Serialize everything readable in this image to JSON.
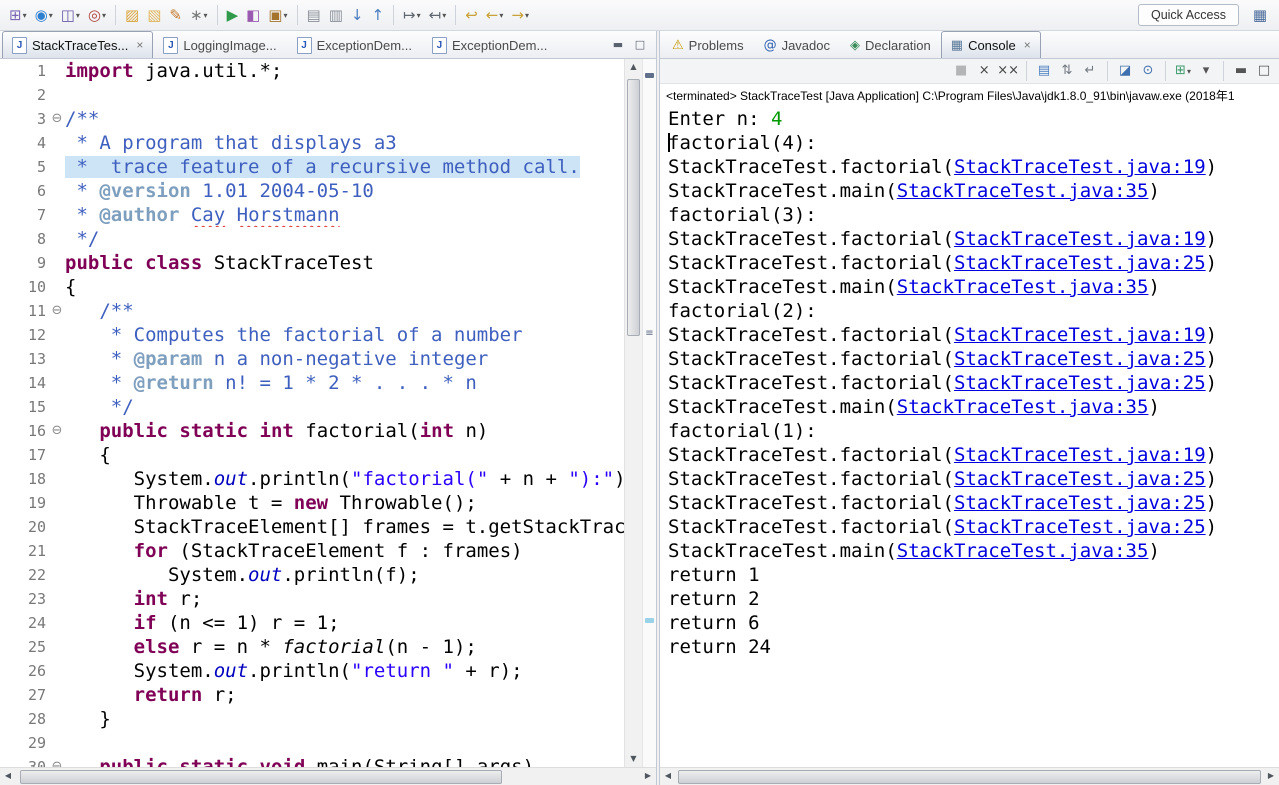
{
  "toolbar": {
    "quick_access": "Quick Access",
    "items": [
      {
        "name": "new-wizard",
        "glyph": "⊞",
        "color": "#7b68b5",
        "dropdown": true
      },
      {
        "name": "launch",
        "glyph": "◉",
        "color": "#2f7fd0",
        "dropdown": true
      },
      {
        "name": "save",
        "glyph": "◫",
        "color": "#6a5aa8",
        "dropdown": true
      },
      {
        "name": "external-tools",
        "glyph": "◎",
        "color": "#b04040",
        "dropdown": true
      },
      {
        "sep": true
      },
      {
        "name": "open-folder",
        "glyph": "▨",
        "color": "#d9a43c"
      },
      {
        "name": "open-type",
        "glyph": "▧",
        "color": "#e0b45a"
      },
      {
        "name": "edit-pencil",
        "glyph": "✎",
        "color": "#c47a2e"
      },
      {
        "name": "magic-wand",
        "glyph": "∗",
        "color": "#7a7a7a",
        "dropdown": true
      },
      {
        "sep": true
      },
      {
        "name": "run",
        "glyph": "▶",
        "color": "#2e9a4a"
      },
      {
        "name": "paint",
        "glyph": "◧",
        "color": "#995ab0"
      },
      {
        "name": "new-package",
        "glyph": "▣",
        "color": "#a5742c",
        "dropdown": true
      },
      {
        "sep": true
      },
      {
        "name": "copy-book",
        "glyph": "▤",
        "color": "#8a8f98"
      },
      {
        "name": "copy-page",
        "glyph": "▥",
        "color": "#8a8f98"
      },
      {
        "name": "import",
        "glyph": "↓",
        "color": "#4a7dbf"
      },
      {
        "name": "export",
        "glyph": "↑",
        "color": "#4a7dbf"
      },
      {
        "sep": true
      },
      {
        "name": "next-annotation",
        "glyph": "↦",
        "color": "#606770",
        "dropdown": true
      },
      {
        "name": "prev-annotation",
        "glyph": "↤",
        "color": "#606770",
        "dropdown": true
      },
      {
        "sep": true
      },
      {
        "name": "last-edit-location",
        "glyph": "↩",
        "color": "#caa23a"
      },
      {
        "name": "back",
        "glyph": "←",
        "color": "#caa23a",
        "dropdown": true
      },
      {
        "name": "forward",
        "glyph": "→",
        "color": "#caa23a",
        "dropdown": true
      }
    ]
  },
  "editor": {
    "tabs": [
      {
        "label": "StackTraceTes...",
        "active": true
      },
      {
        "label": "LoggingImage..."
      },
      {
        "label": "ExceptionDem..."
      },
      {
        "label": "ExceptionDem..."
      }
    ],
    "lines": [
      {
        "n": 1,
        "segs": [
          {
            "c": "kw",
            "t": "import"
          },
          {
            "c": "pl",
            "t": " java.util.*;"
          }
        ]
      },
      {
        "n": 2,
        "segs": []
      },
      {
        "n": 3,
        "fold": true,
        "segs": [
          {
            "c": "jd",
            "t": "/**"
          }
        ]
      },
      {
        "n": 4,
        "segs": [
          {
            "c": "jd",
            "t": " * A program that displays a3"
          }
        ]
      },
      {
        "n": 5,
        "hl": true,
        "segs": [
          {
            "c": "jd",
            "t": " *  trace feature of a recursive method call."
          }
        ]
      },
      {
        "n": 6,
        "segs": [
          {
            "c": "jd",
            "t": " * "
          },
          {
            "c": "jdt",
            "t": "@version"
          },
          {
            "c": "jd",
            "t": " 1.01 2004-05-10"
          }
        ]
      },
      {
        "n": 7,
        "segs": [
          {
            "c": "jd",
            "t": " * "
          },
          {
            "c": "jdt",
            "t": "@author"
          },
          {
            "c": "jd",
            "t": " "
          },
          {
            "c": "jd err",
            "t": "Cay"
          },
          {
            "c": "jd",
            "t": " "
          },
          {
            "c": "jd err",
            "t": "Horstmann"
          }
        ]
      },
      {
        "n": 8,
        "segs": [
          {
            "c": "jd",
            "t": " */"
          }
        ]
      },
      {
        "n": 9,
        "segs": [
          {
            "c": "kw",
            "t": "public"
          },
          {
            "c": "pl",
            "t": " "
          },
          {
            "c": "kw",
            "t": "class"
          },
          {
            "c": "pl",
            "t": " StackTraceTest"
          }
        ]
      },
      {
        "n": 10,
        "segs": [
          {
            "c": "pl",
            "t": "{"
          }
        ]
      },
      {
        "n": 11,
        "fold": true,
        "segs": [
          {
            "c": "pl",
            "t": "   "
          },
          {
            "c": "jd",
            "t": "/**"
          }
        ]
      },
      {
        "n": 12,
        "segs": [
          {
            "c": "jd",
            "t": "    * Computes the factorial of a number"
          }
        ]
      },
      {
        "n": 13,
        "segs": [
          {
            "c": "jd",
            "t": "    * "
          },
          {
            "c": "jdt",
            "t": "@param"
          },
          {
            "c": "jd",
            "t": " n a non-negative integer"
          }
        ]
      },
      {
        "n": 14,
        "segs": [
          {
            "c": "jd",
            "t": "    * "
          },
          {
            "c": "jdt",
            "t": "@return"
          },
          {
            "c": "jd",
            "t": " n! = 1 * 2 * . . . * n"
          }
        ]
      },
      {
        "n": 15,
        "segs": [
          {
            "c": "jd",
            "t": "    */"
          }
        ]
      },
      {
        "n": 16,
        "fold": true,
        "segs": [
          {
            "c": "pl",
            "t": "   "
          },
          {
            "c": "kw",
            "t": "public"
          },
          {
            "c": "pl",
            "t": " "
          },
          {
            "c": "kw",
            "t": "static"
          },
          {
            "c": "pl",
            "t": " "
          },
          {
            "c": "kw",
            "t": "int"
          },
          {
            "c": "pl",
            "t": " factorial("
          },
          {
            "c": "kw",
            "t": "int"
          },
          {
            "c": "pl",
            "t": " n)"
          }
        ]
      },
      {
        "n": 17,
        "segs": [
          {
            "c": "pl",
            "t": "   {"
          }
        ]
      },
      {
        "n": 18,
        "segs": [
          {
            "c": "pl",
            "t": "      System."
          },
          {
            "c": "sf",
            "t": "out"
          },
          {
            "c": "pl",
            "t": ".println("
          },
          {
            "c": "str",
            "t": "\"factorial(\""
          },
          {
            "c": "pl",
            "t": " + n + "
          },
          {
            "c": "str",
            "t": "\"):\""
          },
          {
            "c": "pl",
            "t": ");"
          }
        ]
      },
      {
        "n": 19,
        "segs": [
          {
            "c": "pl",
            "t": "      Throwable t = "
          },
          {
            "c": "kw",
            "t": "new"
          },
          {
            "c": "pl",
            "t": " Throwable();"
          }
        ]
      },
      {
        "n": 20,
        "segs": [
          {
            "c": "pl",
            "t": "      StackTraceElement[] frames = t.getStackTrace();"
          }
        ]
      },
      {
        "n": 21,
        "segs": [
          {
            "c": "pl",
            "t": "      "
          },
          {
            "c": "kw",
            "t": "for"
          },
          {
            "c": "pl",
            "t": " (StackTraceElement f : frames)"
          }
        ]
      },
      {
        "n": 22,
        "segs": [
          {
            "c": "pl",
            "t": "         System."
          },
          {
            "c": "sf",
            "t": "out"
          },
          {
            "c": "pl",
            "t": ".println(f);"
          }
        ]
      },
      {
        "n": 23,
        "segs": [
          {
            "c": "pl",
            "t": "      "
          },
          {
            "c": "kw",
            "t": "int"
          },
          {
            "c": "pl",
            "t": " r;"
          }
        ]
      },
      {
        "n": 24,
        "segs": [
          {
            "c": "pl",
            "t": "      "
          },
          {
            "c": "kw",
            "t": "if"
          },
          {
            "c": "pl",
            "t": " (n <= 1) r = 1;"
          }
        ]
      },
      {
        "n": 25,
        "segs": [
          {
            "c": "pl",
            "t": "      "
          },
          {
            "c": "kw",
            "t": "else"
          },
          {
            "c": "pl",
            "t": " r = n * "
          },
          {
            "c": "sm",
            "t": "factorial"
          },
          {
            "c": "pl",
            "t": "(n - 1);"
          }
        ]
      },
      {
        "n": 26,
        "segs": [
          {
            "c": "pl",
            "t": "      System."
          },
          {
            "c": "sf",
            "t": "out"
          },
          {
            "c": "pl",
            "t": ".println("
          },
          {
            "c": "str",
            "t": "\"return \""
          },
          {
            "c": "pl",
            "t": " + r);"
          }
        ]
      },
      {
        "n": 27,
        "segs": [
          {
            "c": "pl",
            "t": "      "
          },
          {
            "c": "kw",
            "t": "return"
          },
          {
            "c": "pl",
            "t": " r;"
          }
        ]
      },
      {
        "n": 28,
        "segs": [
          {
            "c": "pl",
            "t": "   }"
          }
        ]
      },
      {
        "n": 29,
        "segs": []
      },
      {
        "n": 30,
        "fold": true,
        "segs": [
          {
            "c": "pl",
            "t": "   "
          },
          {
            "c": "kw",
            "t": "public"
          },
          {
            "c": "pl",
            "t": " "
          },
          {
            "c": "kw",
            "t": "static"
          },
          {
            "c": "pl",
            "t": " "
          },
          {
            "c": "kw",
            "t": "void"
          },
          {
            "c": "pl",
            "t": " main(String[] args)"
          }
        ]
      }
    ]
  },
  "console": {
    "tabs": [
      {
        "label": "Problems",
        "icon_name": "problems-icon",
        "icon_glyph": "⚠",
        "icon_color": "#c99700"
      },
      {
        "label": "Javadoc",
        "icon_name": "javadoc-icon",
        "icon_glyph": "@",
        "icon_color": "#2a5db0"
      },
      {
        "label": "Declaration",
        "icon_name": "declaration-icon",
        "icon_glyph": "◈",
        "icon_color": "#3a8d5a"
      },
      {
        "label": "Console",
        "icon_name": "console-icon",
        "icon_glyph": "▦",
        "icon_color": "#5a7a9a",
        "active": true
      }
    ],
    "toolbar_items": [
      {
        "name": "terminate",
        "glyph": "■",
        "color": "#8d4a4a",
        "disabled": true
      },
      {
        "name": "remove-launch",
        "glyph": "×",
        "color": "#444444"
      },
      {
        "name": "remove-all-terminated",
        "glyph": "××",
        "color": "#444444"
      },
      {
        "sep": true
      },
      {
        "name": "clear-console",
        "glyph": "▤",
        "color": "#4a7dbf"
      },
      {
        "name": "scroll-lock",
        "glyph": "⇅",
        "color": "#707880"
      },
      {
        "name": "word-wrap",
        "glyph": "↵",
        "color": "#707880"
      },
      {
        "sep": true
      },
      {
        "name": "show-console-on-stdout",
        "glyph": "◪",
        "color": "#3f6fae"
      },
      {
        "name": "pin-console",
        "glyph": "⊙",
        "color": "#3f6fae"
      },
      {
        "sep": true
      },
      {
        "name": "open-console",
        "glyph": "⊞",
        "color": "#3a9a6a",
        "dropdown": true
      },
      {
        "name": "view-menu",
        "glyph": "▾",
        "color": "#555555"
      },
      {
        "sep": true
      },
      {
        "name": "minimize-view",
        "glyph": "▬",
        "color": "#555555"
      },
      {
        "name": "maximize-view",
        "glyph": "□",
        "color": "#555555"
      }
    ],
    "status": "<terminated> StackTraceTest [Java Application] C:\\Program Files\\Java\\jdk1.8.0_91\\bin\\javaw.exe (2018年1",
    "caret_line": 1,
    "lines": [
      [
        {
          "c": "out",
          "t": "Enter n: "
        },
        {
          "c": "in",
          "t": "4"
        }
      ],
      [
        {
          "c": "out",
          "t": "factorial(4):"
        }
      ],
      [
        {
          "c": "out",
          "t": "StackTraceTest.factorial("
        },
        {
          "c": "link",
          "t": "StackTraceTest.java:19"
        },
        {
          "c": "out",
          "t": ")"
        }
      ],
      [
        {
          "c": "out",
          "t": "StackTraceTest.main("
        },
        {
          "c": "link",
          "t": "StackTraceTest.java:35"
        },
        {
          "c": "out",
          "t": ")"
        }
      ],
      [
        {
          "c": "out",
          "t": "factorial(3):"
        }
      ],
      [
        {
          "c": "out",
          "t": "StackTraceTest.factorial("
        },
        {
          "c": "link",
          "t": "StackTraceTest.java:19"
        },
        {
          "c": "out",
          "t": ")"
        }
      ],
      [
        {
          "c": "out",
          "t": "StackTraceTest.factorial("
        },
        {
          "c": "link",
          "t": "StackTraceTest.java:25"
        },
        {
          "c": "out",
          "t": ")"
        }
      ],
      [
        {
          "c": "out",
          "t": "StackTraceTest.main("
        },
        {
          "c": "link",
          "t": "StackTraceTest.java:35"
        },
        {
          "c": "out",
          "t": ")"
        }
      ],
      [
        {
          "c": "out",
          "t": "factorial(2):"
        }
      ],
      [
        {
          "c": "out",
          "t": "StackTraceTest.factorial("
        },
        {
          "c": "link",
          "t": "StackTraceTest.java:19"
        },
        {
          "c": "out",
          "t": ")"
        }
      ],
      [
        {
          "c": "out",
          "t": "StackTraceTest.factorial("
        },
        {
          "c": "link",
          "t": "StackTraceTest.java:25"
        },
        {
          "c": "out",
          "t": ")"
        }
      ],
      [
        {
          "c": "out",
          "t": "StackTraceTest.factorial("
        },
        {
          "c": "link",
          "t": "StackTraceTest.java:25"
        },
        {
          "c": "out",
          "t": ")"
        }
      ],
      [
        {
          "c": "out",
          "t": "StackTraceTest.main("
        },
        {
          "c": "link",
          "t": "StackTraceTest.java:35"
        },
        {
          "c": "out",
          "t": ")"
        }
      ],
      [
        {
          "c": "out",
          "t": "factorial(1):"
        }
      ],
      [
        {
          "c": "out",
          "t": "StackTraceTest.factorial("
        },
        {
          "c": "link",
          "t": "StackTraceTest.java:19"
        },
        {
          "c": "out",
          "t": ")"
        }
      ],
      [
        {
          "c": "out",
          "t": "StackTraceTest.factorial("
        },
        {
          "c": "link",
          "t": "StackTraceTest.java:25"
        },
        {
          "c": "out",
          "t": ")"
        }
      ],
      [
        {
          "c": "out",
          "t": "StackTraceTest.factorial("
        },
        {
          "c": "link",
          "t": "StackTraceTest.java:25"
        },
        {
          "c": "out",
          "t": ")"
        }
      ],
      [
        {
          "c": "out",
          "t": "StackTraceTest.factorial("
        },
        {
          "c": "link",
          "t": "StackTraceTest.java:25"
        },
        {
          "c": "out",
          "t": ")"
        }
      ],
      [
        {
          "c": "out",
          "t": "StackTraceTest.main("
        },
        {
          "c": "link",
          "t": "StackTraceTest.java:35"
        },
        {
          "c": "out",
          "t": ")"
        }
      ],
      [
        {
          "c": "out",
          "t": "return 1"
        }
      ],
      [
        {
          "c": "out",
          "t": "return 2"
        }
      ],
      [
        {
          "c": "out",
          "t": "return 6"
        }
      ],
      [
        {
          "c": "out",
          "t": "return 24"
        }
      ]
    ]
  }
}
